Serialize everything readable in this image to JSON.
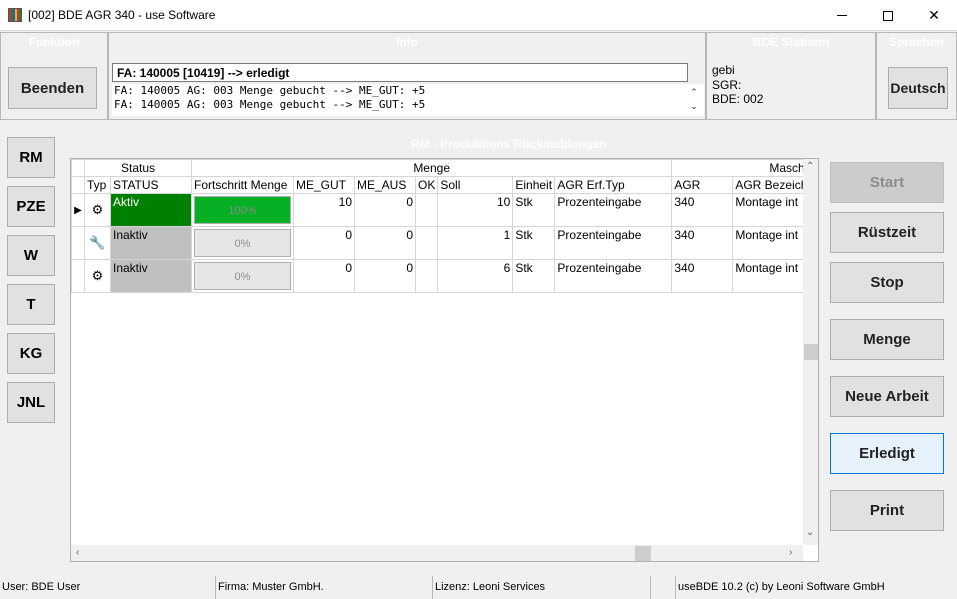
{
  "window": {
    "title": "[002] BDE AGR 340 - use Software"
  },
  "header": {
    "funktion": {
      "title": "Funktion",
      "button": "Beenden"
    },
    "info": {
      "title": "Info",
      "main": "FA: 140005 [10419] --> erledigt",
      "lines": [
        "FA: 140005 AG: 003 Menge gebucht --> ME_GUT: +5",
        "FA: 140005 AG: 003 Menge gebucht --> ME_GUT: +5"
      ]
    },
    "station": {
      "title": "BDE Stationn",
      "user": "gebi",
      "sgr": "SGR:",
      "bde": "BDE: 002"
    },
    "sprachen": {
      "title": "Sprachen",
      "button": "Deutsch"
    }
  },
  "nav": [
    "RM",
    "PZE",
    "W",
    "T",
    "KG",
    "JNL"
  ],
  "rm": {
    "title": "RM - Produktions Rückmeldungen",
    "groups": {
      "status": "Status",
      "menge": "Menge",
      "maschi": "Maschi"
    },
    "columns": [
      "Typ",
      "STATUS",
      "Fortschritt Menge",
      "ME_GUT",
      "ME_AUS",
      "OK",
      "Soll",
      "Einheit",
      "AGR Erf.Typ",
      "AGR",
      "AGR Bezeich"
    ],
    "rows": [
      {
        "typ_icon": "gear-icon",
        "status": "Aktiv",
        "progress": 100,
        "progress_label": "100%",
        "me_gut": "10",
        "me_aus": "0",
        "ok": "",
        "soll": "10",
        "einheit": "Stk",
        "erf_typ": "Prozenteingabe",
        "agr": "340",
        "bezeich": "Montage int"
      },
      {
        "typ_icon": "wrench-icon",
        "status": "Inaktiv",
        "progress": 0,
        "progress_label": "0%",
        "me_gut": "0",
        "me_aus": "0",
        "ok": "",
        "soll": "1",
        "einheit": "Stk",
        "erf_typ": "Prozenteingabe",
        "agr": "340",
        "bezeich": "Montage int"
      },
      {
        "typ_icon": "gear-icon",
        "status": "Inaktiv",
        "progress": 0,
        "progress_label": "0%",
        "me_gut": "0",
        "me_aus": "0",
        "ok": "",
        "soll": "6",
        "einheit": "Stk",
        "erf_typ": "Prozenteingabe",
        "agr": "340",
        "bezeich": "Montage int"
      }
    ]
  },
  "actions": {
    "start": "Start",
    "ruestzeit": "Rüstzeit",
    "stop": "Stop",
    "menge": "Menge",
    "neue_arbeit": "Neue Arbeit",
    "erledigt": "Erledigt",
    "print": "Print"
  },
  "statusbar": {
    "user": "User: BDE User",
    "firma": "Firma: Muster GmbH.",
    "lizenz": "Lizenz: Leoni Services",
    "empty": "",
    "version": "useBDE 10.2 (c) by Leoni Software GmbH"
  },
  "colors": {
    "aktiv": "#008000",
    "inaktiv": "#c0c0c0",
    "progress": "#06b025"
  }
}
